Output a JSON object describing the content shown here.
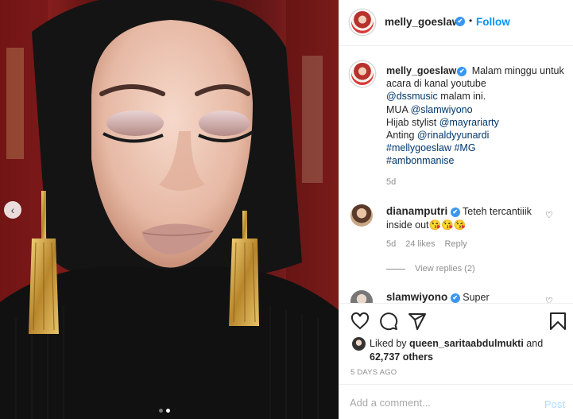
{
  "post": {
    "carousel": {
      "prev_icon": "chevron-left-icon",
      "slide_count": 2,
      "active_slide": 2
    }
  },
  "header": {
    "username": "melly_goeslaw",
    "verified_icon": "✔",
    "separator": "•",
    "follow_label": "Follow"
  },
  "caption": {
    "username": "melly_goeslaw",
    "lines": [
      "Malam minggu untuk acara di kanal youtube",
      "@dssmusic",
      " malam ini.",
      "MUA ",
      "@slamwiyono",
      "Hijab stylist ",
      "@mayrariarty",
      "Anting ",
      "@rinaldyyunardi",
      "#mellygoeslaw",
      "#MG",
      "#ambonmanise"
    ],
    "time": "5d"
  },
  "comments": [
    {
      "username": "dianamputri",
      "text": "Teteh tercantiiik inside out😘😘😘",
      "time": "5d",
      "likes": "24 likes",
      "reply_label": "Reply",
      "view_replies": "View replies (2)"
    },
    {
      "username": "slamwiyono",
      "text": "Super"
    }
  ],
  "actions": {
    "like_icon": "heart-icon",
    "comment_icon": "comment-icon",
    "share_icon": "share-icon",
    "save_icon": "bookmark-icon"
  },
  "likes": {
    "prefix": "Liked by ",
    "user": "queen_saritaabdulmukti",
    "mid": " and",
    "count": "62,737 others"
  },
  "post_age": "5 DAYS AGO",
  "add_comment": {
    "placeholder": "Add a comment...",
    "post_label": "Post"
  },
  "colors": {
    "accent": "#0095f6",
    "verified": "#3897f0",
    "mention": "#00376b",
    "muted": "#8e8e8e"
  }
}
